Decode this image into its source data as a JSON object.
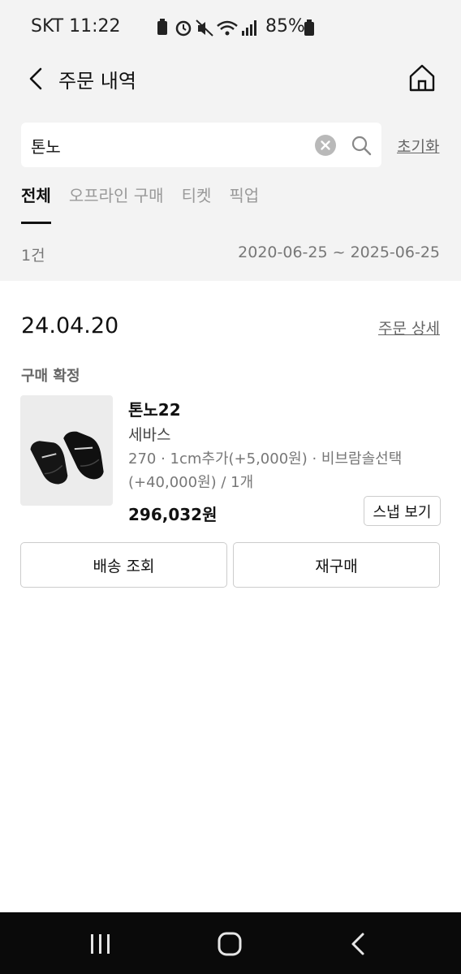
{
  "status_bar": {
    "carrier_time": "SKT 11:22",
    "battery": "85%"
  },
  "header": {
    "title": "주문 내역",
    "back_icon": "chevron-left-icon",
    "home_icon": "home-icon"
  },
  "search": {
    "value": "톤노",
    "reset_label": "초기화",
    "clear_icon": "clear-icon",
    "search_icon": "search-icon"
  },
  "tabs": [
    {
      "label": "전체",
      "active": true
    },
    {
      "label": "오프라인 구매",
      "active": false
    },
    {
      "label": "티켓",
      "active": false
    },
    {
      "label": "픽업",
      "active": false
    }
  ],
  "summary": {
    "count": "1건",
    "date_range": "2020-06-25 ~ 2025-06-25"
  },
  "order": {
    "date": "24.04.20",
    "detail_link": "주문 상세",
    "status": "구매 확정",
    "product": {
      "name": "톤노22",
      "brand": "세바스",
      "options": "270 · 1cm추가(+5,000원) · 비브람솔선택 (+40,000원) / 1개",
      "price": "296,032원"
    },
    "snap_label": "스냅 보기",
    "ship_label": "배송 조회",
    "rebuy_label": "재구매"
  },
  "colors": {
    "top_background": "#f3f3f3",
    "nav_background": "#0a0a0a",
    "link_gray": "#666666"
  }
}
